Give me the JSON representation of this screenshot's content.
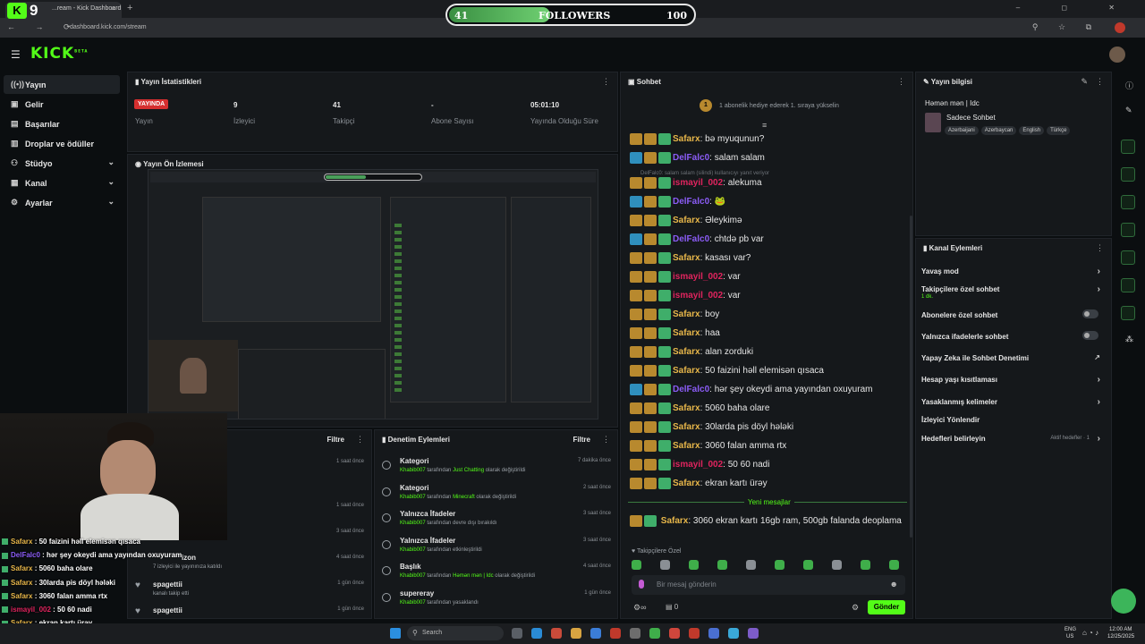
{
  "browser": {
    "tab_title": "...ream - Kick Dashboard",
    "url": "dashboard.kick.com/stream",
    "tab_close": "×",
    "new_tab": "+",
    "window_controls": "– ◻ ✕",
    "nav": "← → ⟳",
    "ext": "⚲ ☆ ⧉"
  },
  "overlay": {
    "kick_badge_number": "9",
    "followers_current": "41",
    "followers_label": "FOLLOWERS",
    "followers_goal": "100",
    "followers_progress": 0.41
  },
  "header": {
    "logo": "KICK",
    "logo_tag": "BETA"
  },
  "sidebar": {
    "items": [
      {
        "label": "Yayın",
        "icon": "broadcast-icon"
      },
      {
        "label": "Gelir",
        "icon": "money-icon"
      },
      {
        "label": "Başarılar",
        "icon": "trophy-icon"
      },
      {
        "label": "Droplar ve ödüller",
        "icon": "gift-icon"
      },
      {
        "label": "Stüdyo",
        "icon": "studio-icon"
      },
      {
        "label": "Kanal",
        "icon": "channel-icon"
      },
      {
        "label": "Ayarlar",
        "icon": "settings-icon"
      }
    ]
  },
  "stats": {
    "title": "Yayın İstatistikleri",
    "live_badge": "YAYINDA",
    "items": [
      {
        "value": "",
        "label": "Yayın"
      },
      {
        "value": "9",
        "label": "İzleyici"
      },
      {
        "value": "41",
        "label": "Takipçi"
      },
      {
        "value": "-",
        "label": "Abone Sayısı"
      },
      {
        "value": "05:01:10",
        "label": "Yayında Olduğu Süre"
      }
    ]
  },
  "preview": {
    "title": "Yayın Ön İzlemesi"
  },
  "chat": {
    "title": "Sohbet",
    "pinned": "1 abonelik hediye ederek 1. sıraya yükselin",
    "deleted_note": "DelFalc0: salam salam (silindi) kullanıcıyı yanıt veriyor",
    "messages": [
      {
        "user": "Safarx",
        "color": "#e8b74a",
        "text": "bə myuqunun?",
        "gift": false
      },
      {
        "user": "DelFalc0",
        "color": "#8b5cf6",
        "text": "salam salam",
        "gift": true
      },
      {
        "user": "ismayil_002",
        "color": "#e0245e",
        "text": "alekuma",
        "gift": false
      },
      {
        "user": "DelFalc0",
        "color": "#8b5cf6",
        "text": "🐸",
        "gift": true
      },
      {
        "user": "Safarx",
        "color": "#e8b74a",
        "text": "Əleykimə",
        "gift": false
      },
      {
        "user": "DelFalc0",
        "color": "#8b5cf6",
        "text": "chtdə pb var",
        "gift": true
      },
      {
        "user": "Safarx",
        "color": "#e8b74a",
        "text": "kasası var?",
        "gift": false
      },
      {
        "user": "ismayil_002",
        "color": "#e0245e",
        "text": "var",
        "gift": false
      },
      {
        "user": "ismayil_002",
        "color": "#e0245e",
        "text": "var",
        "gift": false
      },
      {
        "user": "Safarx",
        "color": "#e8b74a",
        "text": "boy",
        "gift": false
      },
      {
        "user": "Safarx",
        "color": "#e8b74a",
        "text": "haa",
        "gift": false
      },
      {
        "user": "Safarx",
        "color": "#e8b74a",
        "text": "alan zorduki",
        "gift": false
      },
      {
        "user": "Safarx",
        "color": "#e8b74a",
        "text": "50 faizini həll elemisən qısaca",
        "gift": false
      },
      {
        "user": "DelFalc0",
        "color": "#8b5cf6",
        "text": "hər şey okeydi ama yayından oxuyuram",
        "gift": true
      },
      {
        "user": "Safarx",
        "color": "#e8b74a",
        "text": "5060 baha olare",
        "gift": false
      },
      {
        "user": "Safarx",
        "color": "#e8b74a",
        "text": "30larda pis döyl həlәki",
        "gift": false
      },
      {
        "user": "Safarx",
        "color": "#e8b74a",
        "text": "3060 falan amma rtx",
        "gift": false
      },
      {
        "user": "ismayil_002",
        "color": "#e0245e",
        "text": "50 60 nadi",
        "gift": false
      },
      {
        "user": "Safarx",
        "color": "#e8b74a",
        "text": "ekran kartı ürəy",
        "gift": false
      }
    ],
    "new_messages": "Yeni mesajlar",
    "last_message": {
      "user": "Safarx",
      "color": "#e8b74a",
      "text": "3060 ekran kartı 16gb ram, 500gb falanda deoplama"
    },
    "followers_only": "Takipçilere Özel",
    "input_placeholder": "Bir mesaj gönderin",
    "viewer_count": "0",
    "send_label": "Gönder"
  },
  "stream_info": {
    "title": "Yayın bilgisi",
    "stream_name": "Həmən mən | Idc",
    "category": "Sadece Sohbet",
    "tags": [
      "Azerbaijani",
      "Azerbaycan",
      "English",
      "Türkçe"
    ]
  },
  "channel_actions": {
    "title": "Kanal Eylemleri",
    "items": [
      {
        "label": "Yavaş mod",
        "control": "chevron"
      },
      {
        "label": "Takipçilere özel sohbet",
        "sub": "1 dk.",
        "control": "chevron"
      },
      {
        "label": "Abonelere özel sohbet",
        "control": "toggle"
      },
      {
        "label": "Yalnızca ifadelerle sohbet",
        "control": "toggle"
      },
      {
        "label": "Yapay Zeka ile Sohbet Denetimi",
        "control": "external"
      },
      {
        "label": "Hesap yaşı kısıtlaması",
        "control": "chevron"
      },
      {
        "label": "Yasaklanmış kelimeler",
        "control": "chevron"
      },
      {
        "label": "İzleyici Yönlendir",
        "control": "none"
      },
      {
        "label": "Hedefleri belirleyin",
        "sub": "Aktif hedefler · 1",
        "control": "chevron"
      }
    ]
  },
  "activity": {
    "filter_label": "Filtre",
    "times": [
      "1 saat önce",
      "1 saat önce",
      "3 saat önce",
      "4 saat önce",
      "1 gün önce",
      "1 gün önce"
    ],
    "rows": [
      {
        "text": "izon",
        "sub": "7 izleyici ile yayınınıza katıldı"
      },
      {
        "text": "spagettii",
        "sub": "kanalı takip etti"
      },
      {
        "text": "spagettii",
        "sub": ""
      }
    ]
  },
  "moderation": {
    "title": "Denetim Eylemleri",
    "filter_label": "Filtre",
    "rows": [
      {
        "title": "Kategori",
        "by": "Khabib007",
        "mid": " tarafından ",
        "hl": "Just Chatting",
        "end": " olarak değiştirildi",
        "time": "7 dakika önce"
      },
      {
        "title": "Kategori",
        "by": "Khabib007",
        "mid": " tarafından ",
        "hl": "Minecraft",
        "end": " olarak değiştirildi",
        "time": "2 saat önce"
      },
      {
        "title": "Yalnızca İfadeler",
        "by": "Khabib007",
        "mid": " tarafından devre dışı bırakıldı",
        "hl": "",
        "end": "",
        "time": "3 saat önce"
      },
      {
        "title": "Yalnızca İfadeler",
        "by": "Khabib007",
        "mid": " tarafından etkinleştirildi",
        "hl": "",
        "end": "",
        "time": "3 saat önce"
      },
      {
        "title": "Başlık",
        "by": "Khabib007",
        "mid": " tarafından ",
        "hl": "Həmən mən | Idc",
        "end": " olarak değiştirildi",
        "time": "4 saat önce"
      },
      {
        "title": "supereray",
        "by": "Khabib007",
        "mid": " tarafından yasaklandı",
        "hl": "",
        "end": "",
        "time": "1 gün önce"
      }
    ]
  },
  "overlay_chat": [
    {
      "user": "Safarx",
      "color": "#e8b74a",
      "text": "50 faizini həll elemisən qısaca"
    },
    {
      "user": "DelFalc0",
      "color": "#8b5cf6",
      "text": "hər şey okeydi ama yayından oxuyuram"
    },
    {
      "user": "Safarx",
      "color": "#e8b74a",
      "text": "5060 baha olare"
    },
    {
      "user": "Safarx",
      "color": "#e8b74a",
      "text": "30larda pis döyl həlәki"
    },
    {
      "user": "Safarx",
      "color": "#e8b74a",
      "text": "3060 falan amma rtx"
    },
    {
      "user": "ismayil_002",
      "color": "#e0245e",
      "text": "50 60 nadi"
    },
    {
      "user": "Safarx",
      "color": "#e8b74a",
      "text": "ekran kartı ürəy"
    },
    {
      "user": "Safarx",
      "color": "#e8b74a",
      "text": "3060 ekran kartı 16gb ram, 500gb falanda deoplama"
    }
  ],
  "taskbar": {
    "search_placeholder": "Search",
    "lang": "ENG",
    "region": "US",
    "time": "12:00 AM",
    "date": "12/25/2025"
  },
  "colors": {
    "accent": "#53fc18",
    "live": "#d62f2f",
    "bg": "#0b0e10",
    "panel": "#15181b"
  }
}
